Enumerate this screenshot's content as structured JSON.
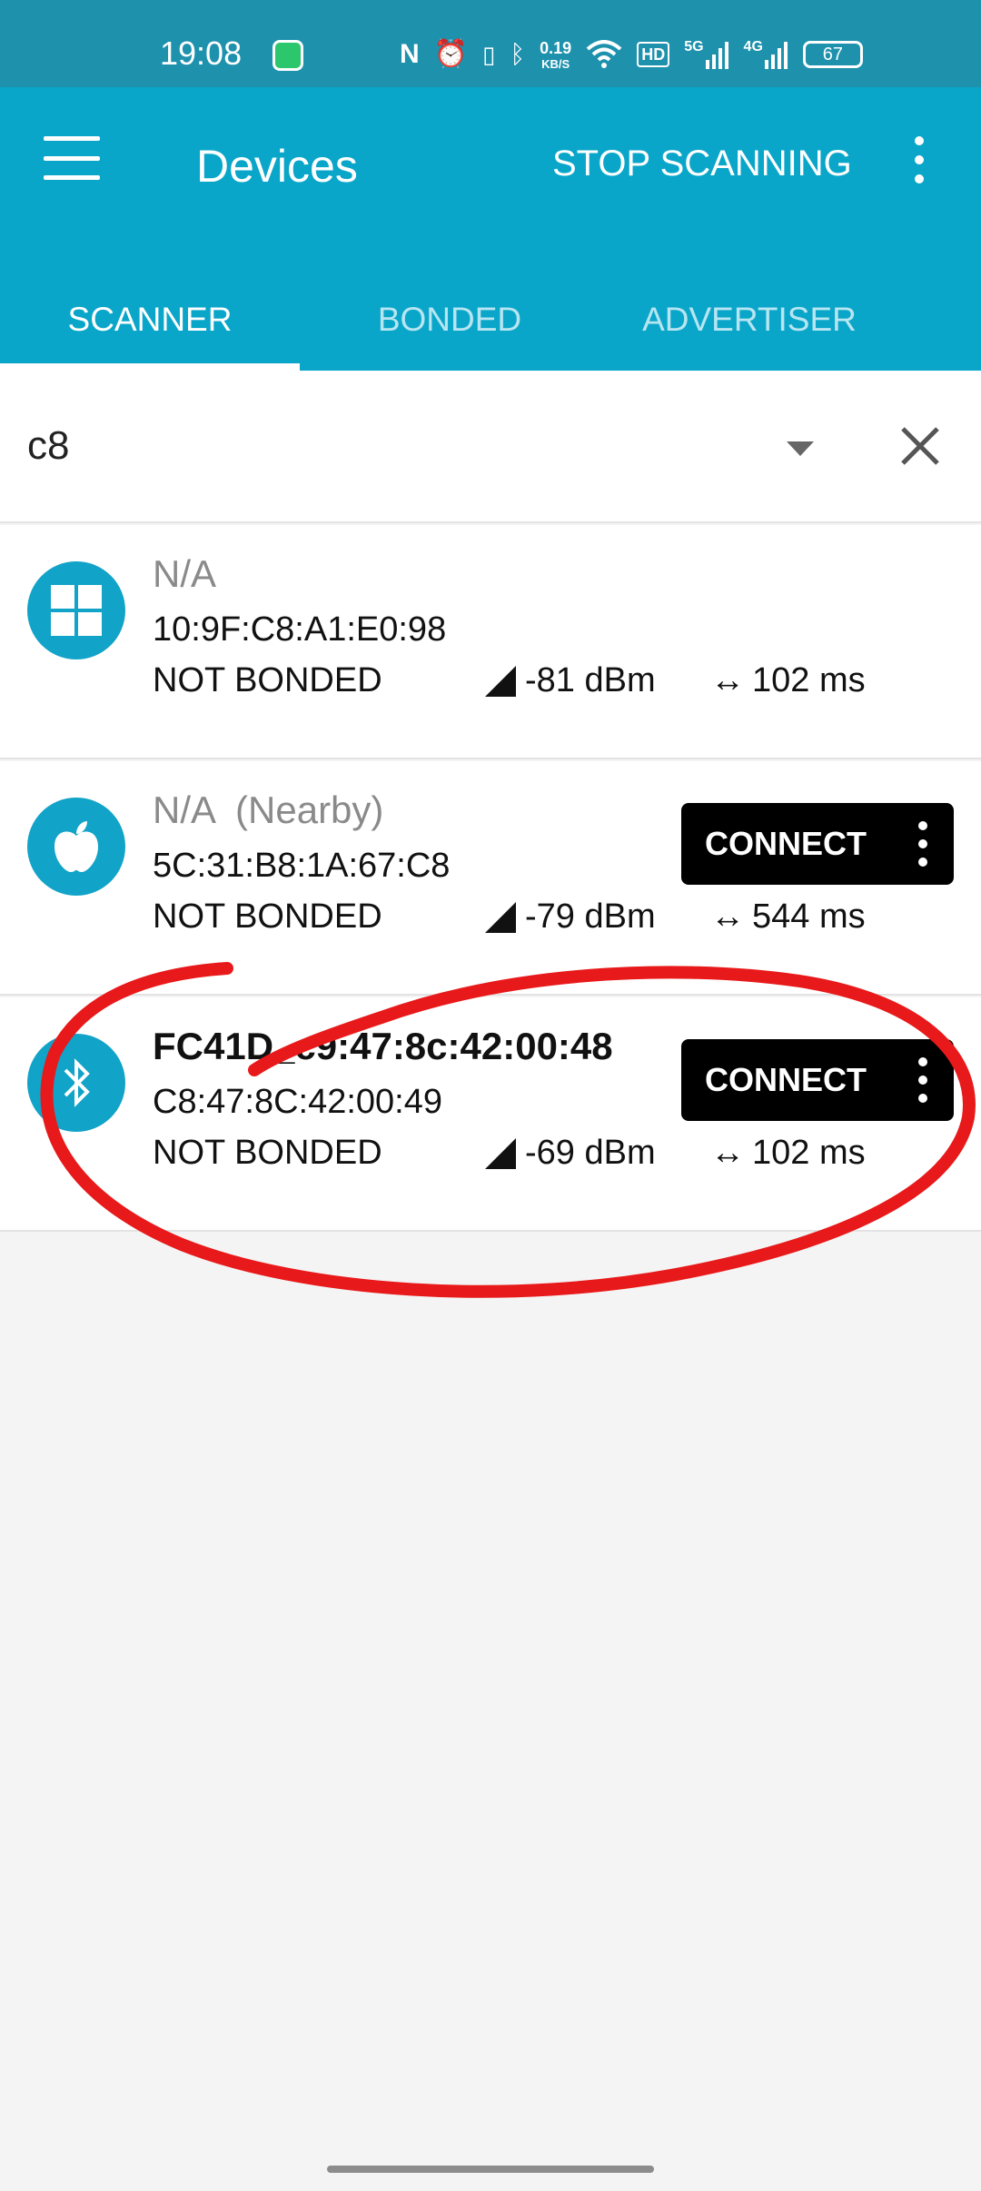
{
  "status_bar": {
    "time": "19:08",
    "net_speed": "0.19",
    "net_unit": "KB/S",
    "battery": "67",
    "icons": [
      "spotify-icon",
      "nfc-icon",
      "alarm-icon",
      "vibrate-icon",
      "bluetooth-icon",
      "wifi-icon",
      "hd-icon",
      "signal-5g-icon",
      "signal-4g-icon",
      "battery-icon"
    ],
    "hd_label": "HD",
    "sig1_label": "5G",
    "sig2_label": "4G"
  },
  "app_bar": {
    "title": "Devices",
    "action": "STOP SCANNING",
    "color": "#0aa6c9"
  },
  "tabs": [
    {
      "label": "SCANNER",
      "active": true
    },
    {
      "label": "BONDED",
      "active": false
    },
    {
      "label": "ADVERTISER",
      "active": false
    }
  ],
  "filter": {
    "value": "c8"
  },
  "devices": [
    {
      "name": "N/A",
      "address": "10:9F:C8:A1:E0:98",
      "bond": "NOT BONDED",
      "rssi": "-81 dBm",
      "interval": "102 ms",
      "icon": "windows-icon",
      "connect": null
    },
    {
      "name": "N/A  (Nearby)",
      "address": "5C:31:B8:1A:67:C8",
      "bond": "NOT BONDED",
      "rssi": "-79 dBm",
      "interval": "544 ms",
      "icon": "apple-icon",
      "connect": "CONNECT"
    },
    {
      "name": "FC41D_c9:47:8c:42:00:48",
      "address": "C8:47:8C:42:00:49",
      "bond": "NOT BONDED",
      "rssi": "-69 dBm",
      "interval": "102 ms",
      "icon": "bluetooth-icon",
      "connect": "CONNECT"
    }
  ],
  "annotation_color": "#e8191a"
}
